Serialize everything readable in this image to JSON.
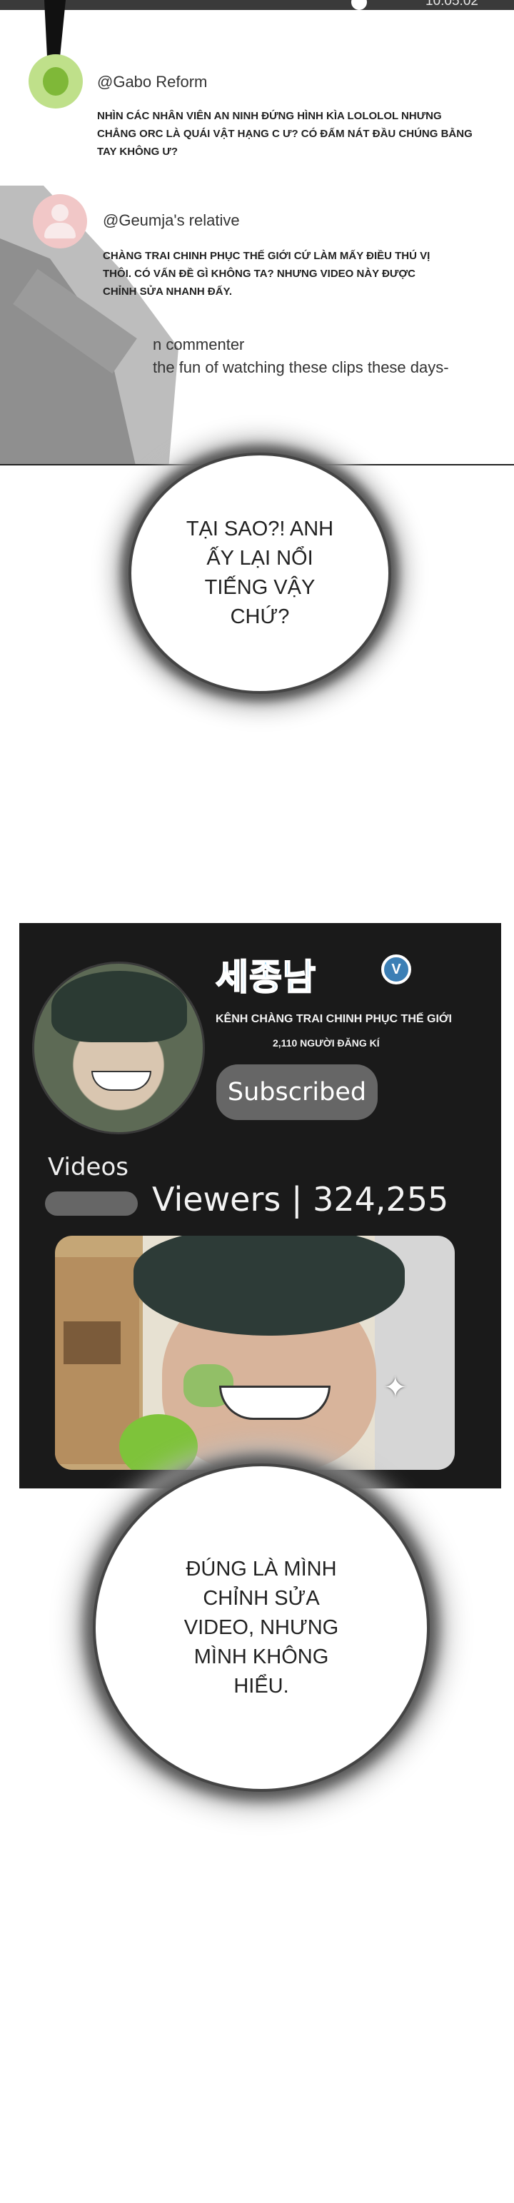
{
  "status_bar": {
    "time": "10:05:02"
  },
  "comments": [
    {
      "user": "@Gabo Reform",
      "text": "NHÌN CÁC NHÂN VIÊN AN NINH ĐỨNG HÌNH KÌA LOLOLOL NHƯNG CHẲNG ORC LÀ QUÁI VẬT HẠNG C Ư? CÓ ĐẤM NÁT ĐẦU CHÚNG BẰNG TAY KHÔNG Ư?"
    },
    {
      "user": "@Geumja's relative",
      "text": "CHÀNG TRAI CHINH PHỤC THẾ GIỚI CỨ LÀM MẤY ĐIỀU THÚ VỊ THÔI. CÓ VẤN ĐỀ GÌ KHÔNG TA? NHƯNG VIDEO NÀY ĐƯỢC CHỈNH SỬA NHANH ĐẤY."
    },
    {
      "user": "n commenter",
      "text": "the fun of watching these clips these days-"
    }
  ],
  "bubbles": {
    "top": "TẠI SAO?! ANH ẤY LẠI NỔI TIẾNG VẬY CHỨ?",
    "bottom": "ĐÚNG LÀ MÌNH CHỈNH SỬA VIDEO, NHƯNG MÌNH KHÔNG HIỂU."
  },
  "channel": {
    "logo_text": "세종남",
    "verified_letter": "V",
    "name": "KÊNH CHÀNG TRAI CHINH PHỤC THẾ GIỚI",
    "subscribers": "2,110 NGƯỜI ĐĂNG KÍ",
    "subscribe_button": "Subscribed",
    "videos_label": "Videos",
    "viewers": "Viewers | 324,255"
  },
  "icons": {
    "verified": "verified-badge-icon",
    "sparkle": "sparkle-icon"
  },
  "colors": {
    "panel_bg": "#1a1a1a",
    "logo": "#8fd2f6",
    "badge": "#3c7fb5",
    "button": "#666666"
  }
}
